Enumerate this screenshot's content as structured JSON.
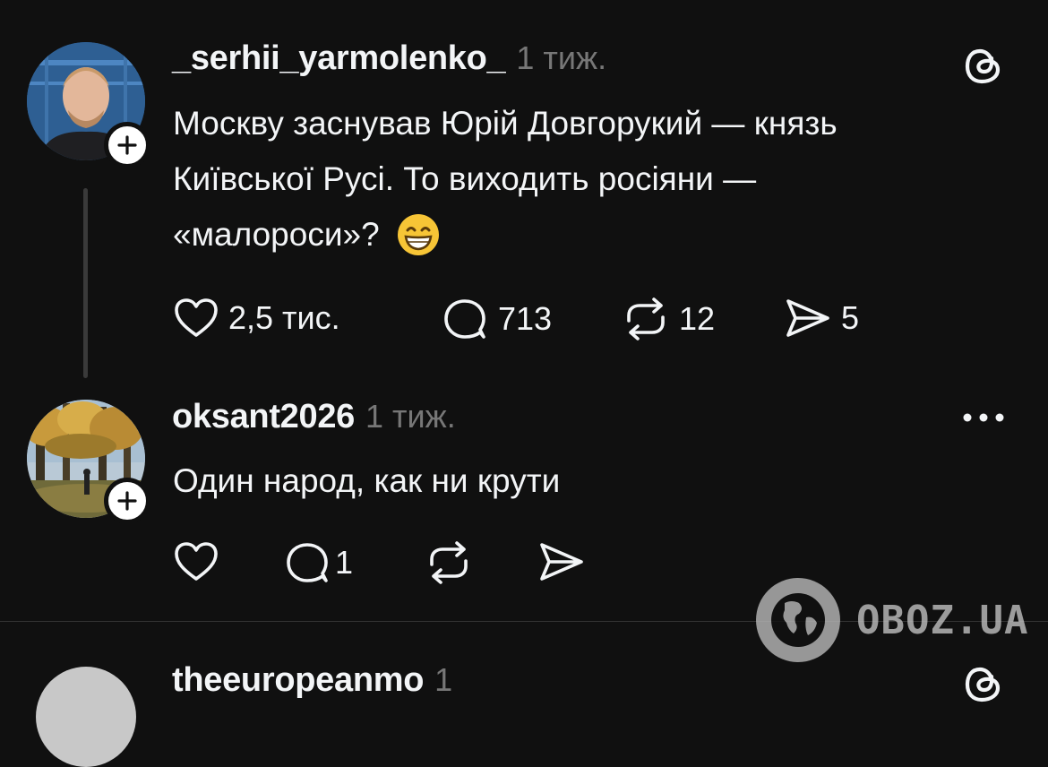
{
  "posts": [
    {
      "username": "_serhii_yarmolenko_",
      "time": "1 тиж.",
      "text_lines": [
        "Москву заснував Юрій Довгорукий — князь",
        "Київської Русі. То виходить росіяни —",
        "«малороси»?"
      ],
      "likes": "2,5 тис.",
      "replies": "713",
      "reposts": "12",
      "shares": "5"
    },
    {
      "username": "oksant2026",
      "time": "1 тиж.",
      "text": "Один народ, как ни крути",
      "likes": "",
      "replies": "1",
      "reposts": "",
      "shares": ""
    },
    {
      "username": "theeuropeanmo",
      "time": "1"
    }
  ],
  "watermark": {
    "text": "OBOZ.UA"
  },
  "icons": {
    "threads": "threads-icon",
    "more": "more-dots-icon",
    "like": "heart-icon",
    "reply": "comment-icon",
    "repost": "repost-icon",
    "share": "send-icon"
  }
}
